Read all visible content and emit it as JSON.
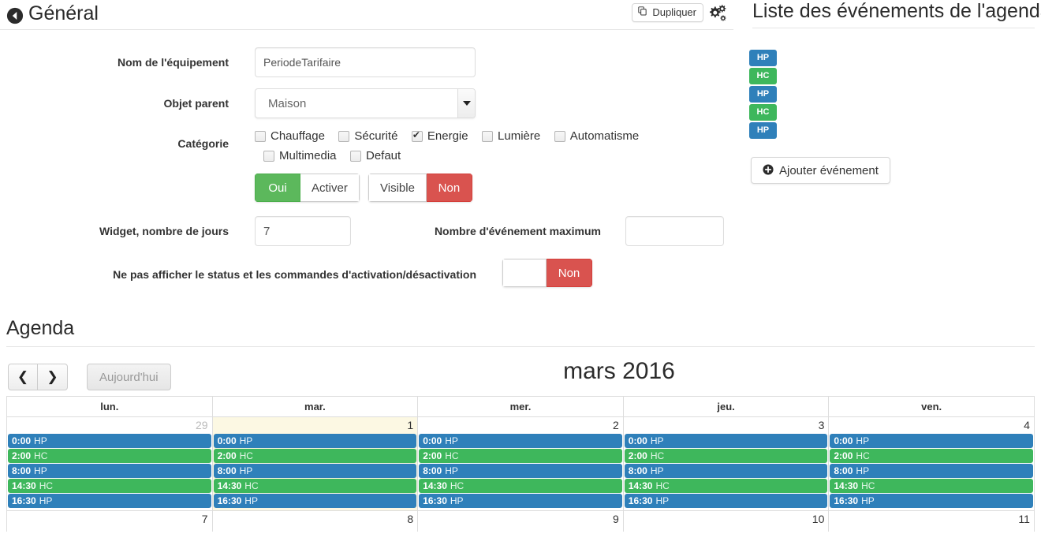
{
  "general": {
    "title": "Général",
    "back_icon": "circle-arrow-left-icon",
    "duplicate_label": "Dupliquer",
    "duplicate_icon": "copy-icon",
    "config_icon": "gears-icon"
  },
  "form": {
    "name_label": "Nom de l'équipement",
    "name_value": "PeriodeTarifaire",
    "parent_label": "Objet parent",
    "parent_value": "Maison",
    "category_label": "Catégorie",
    "categories": [
      {
        "label": "Chauffage",
        "checked": false
      },
      {
        "label": "Sécurité",
        "checked": false
      },
      {
        "label": "Energie",
        "checked": true
      },
      {
        "label": "Lumière",
        "checked": false
      },
      {
        "label": "Automatisme",
        "checked": false
      },
      {
        "label": "Multimedia",
        "checked": false
      },
      {
        "label": "Defaut",
        "checked": false
      }
    ],
    "enable_group": {
      "on_label": "Oui",
      "off_label": "Activer",
      "state": "on"
    },
    "visible_group": {
      "on_label": "Visible",
      "off_label": "Non",
      "state": "off"
    },
    "widget_days_label": "Widget, nombre de jours",
    "widget_days_value": "7",
    "max_events_label": "Nombre d'événement maximum",
    "max_events_value": "",
    "hide_status_label": "Ne pas afficher le status et les commandes d'activation/désactivation",
    "hide_status_group": {
      "on_label": "",
      "off_label": "Non",
      "state": "off"
    }
  },
  "events_panel": {
    "title": "Liste des événements de l'agenda",
    "badges": [
      {
        "label": "HP",
        "kind": "hp"
      },
      {
        "label": "HC",
        "kind": "hc"
      },
      {
        "label": "HP",
        "kind": "hp"
      },
      {
        "label": "HC",
        "kind": "hc"
      },
      {
        "label": "HP",
        "kind": "hp"
      }
    ],
    "add_label": "Ajouter événement",
    "add_icon": "plus-circle-icon"
  },
  "agenda": {
    "title": "Agenda",
    "prev_icon": "chevron-left-icon",
    "next_icon": "chevron-right-icon",
    "today_label": "Aujourd'hui",
    "month_label": "mars 2016",
    "day_headers": [
      "lun.",
      "mar.",
      "mer.",
      "jeu.",
      "ven."
    ],
    "weeks": [
      {
        "days": [
          {
            "num": "29",
            "other_month": true,
            "today": false,
            "events": [
              {
                "time": "0:00",
                "title": "HP",
                "kind": "hp"
              },
              {
                "time": "2:00",
                "title": "HC",
                "kind": "hc"
              },
              {
                "time": "8:00",
                "title": "HP",
                "kind": "hp"
              },
              {
                "time": "14:30",
                "title": "HC",
                "kind": "hc"
              },
              {
                "time": "16:30",
                "title": "HP",
                "kind": "hp"
              }
            ]
          },
          {
            "num": "1",
            "other_month": false,
            "today": true,
            "events": [
              {
                "time": "0:00",
                "title": "HP",
                "kind": "hp"
              },
              {
                "time": "2:00",
                "title": "HC",
                "kind": "hc"
              },
              {
                "time": "8:00",
                "title": "HP",
                "kind": "hp"
              },
              {
                "time": "14:30",
                "title": "HC",
                "kind": "hc"
              },
              {
                "time": "16:30",
                "title": "HP",
                "kind": "hp"
              }
            ]
          },
          {
            "num": "2",
            "other_month": false,
            "today": false,
            "events": [
              {
                "time": "0:00",
                "title": "HP",
                "kind": "hp"
              },
              {
                "time": "2:00",
                "title": "HC",
                "kind": "hc"
              },
              {
                "time": "8:00",
                "title": "HP",
                "kind": "hp"
              },
              {
                "time": "14:30",
                "title": "HC",
                "kind": "hc"
              },
              {
                "time": "16:30",
                "title": "HP",
                "kind": "hp"
              }
            ]
          },
          {
            "num": "3",
            "other_month": false,
            "today": false,
            "events": [
              {
                "time": "0:00",
                "title": "HP",
                "kind": "hp"
              },
              {
                "time": "2:00",
                "title": "HC",
                "kind": "hc"
              },
              {
                "time": "8:00",
                "title": "HP",
                "kind": "hp"
              },
              {
                "time": "14:30",
                "title": "HC",
                "kind": "hc"
              },
              {
                "time": "16:30",
                "title": "HP",
                "kind": "hp"
              }
            ]
          },
          {
            "num": "4",
            "other_month": false,
            "today": false,
            "events": [
              {
                "time": "0:00",
                "title": "HP",
                "kind": "hp"
              },
              {
                "time": "2:00",
                "title": "HC",
                "kind": "hc"
              },
              {
                "time": "8:00",
                "title": "HP",
                "kind": "hp"
              },
              {
                "time": "14:30",
                "title": "HC",
                "kind": "hc"
              },
              {
                "time": "16:30",
                "title": "HP",
                "kind": "hp"
              }
            ]
          }
        ]
      },
      {
        "days": [
          {
            "num": "7",
            "other_month": false,
            "today": false,
            "events": []
          },
          {
            "num": "8",
            "other_month": false,
            "today": false,
            "events": []
          },
          {
            "num": "9",
            "other_month": false,
            "today": false,
            "events": []
          },
          {
            "num": "10",
            "other_month": false,
            "today": false,
            "events": []
          },
          {
            "num": "11",
            "other_month": false,
            "today": false,
            "events": []
          }
        ]
      }
    ]
  },
  "colors": {
    "event_hp": "#2f80ba",
    "event_hc": "#3eb75c",
    "toggle_on": "#5cb85c",
    "toggle_off": "#d9534f",
    "today_bg": "#fcf8e3"
  }
}
